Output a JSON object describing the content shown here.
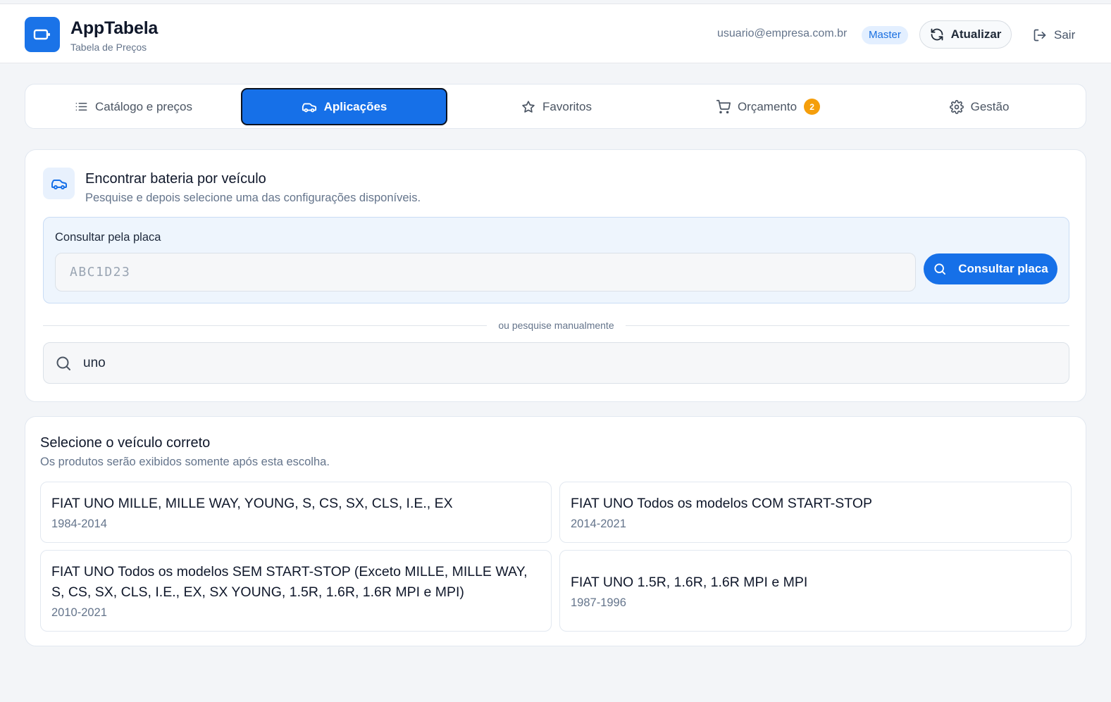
{
  "app": {
    "title": "AppTabela",
    "subtitle": "Tabela de Preços"
  },
  "header": {
    "user_email": "usuario@empresa.com.br",
    "role_badge": "Master",
    "refresh_label": "Atualizar",
    "logout_label": "Sair"
  },
  "tabs": [
    {
      "label": "Catálogo e preços",
      "icon": "list-icon",
      "active": false
    },
    {
      "label": "Aplicações",
      "icon": "car-icon",
      "active": true
    },
    {
      "label": "Favoritos",
      "icon": "star-icon",
      "active": false
    },
    {
      "label": "Orçamento",
      "icon": "cart-icon",
      "active": false,
      "badge": "2"
    },
    {
      "label": "Gestão",
      "icon": "gear-icon",
      "active": false
    }
  ],
  "vehicle_search": {
    "title": "Encontrar bateria por veículo",
    "subtitle": "Pesquise e depois selecione uma das configurações disponíveis.",
    "plate": {
      "label": "Consultar pela placa",
      "placeholder": "ABC1D23",
      "value": "",
      "button_label": "Consultar placa"
    },
    "divider_text": "ou pesquise manualmente",
    "manual_search_value": "uno"
  },
  "results": {
    "title": "Selecione o veículo correto",
    "subtitle": "Os produtos serão exibidos somente após esta escolha.",
    "vehicles": [
      {
        "name": "FIAT UNO MILLE, MILLE WAY, YOUNG, S, CS, SX, CLS, I.E., EX",
        "years": "1984-2014"
      },
      {
        "name": "FIAT UNO Todos os modelos COM START-STOP",
        "years": "2014-2021"
      },
      {
        "name": "FIAT UNO Todos os modelos SEM START-STOP (Exceto MILLE, MILLE WAY, S, CS, SX, CLS, I.E., EX, SX YOUNG, 1.5R, 1.6R, 1.6R MPI e MPI)",
        "years": "2010-2021"
      },
      {
        "name": "FIAT UNO 1.5R, 1.6R, 1.6R MPI e MPI",
        "years": "1987-1996"
      }
    ]
  },
  "colors": {
    "primary": "#1670e8",
    "badge_warning": "#f59e0b",
    "background": "#f3f5f8"
  }
}
